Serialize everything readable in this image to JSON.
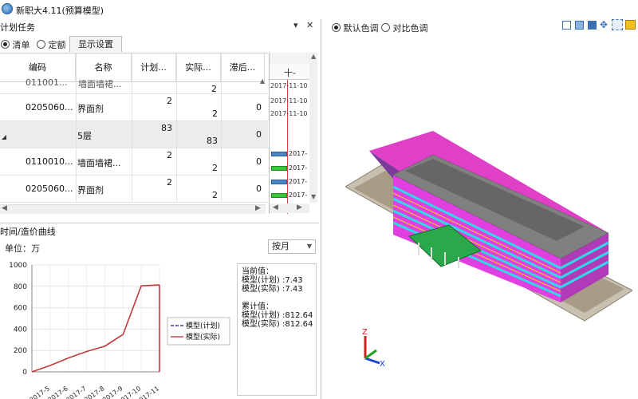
{
  "window": {
    "title": "新职大4.11(预算模型)"
  },
  "plan_pane": {
    "title": "计划任务",
    "pin_icon": "▾",
    "close_icon": "✕",
    "tabs": {
      "list": "清单",
      "quota": "定额",
      "display_settings": "显示设置"
    },
    "columns": [
      "编码",
      "名称",
      "计划...",
      "实际...",
      "滞后..."
    ],
    "rows": [
      {
        "code": "011001...",
        "name": "墙面墙裙...",
        "plan": "",
        "actual": "2",
        "lag": "0"
      },
      {
        "code": "0205060...",
        "name": "界面剂",
        "plan": "2",
        "actual": "2",
        "lag": "0"
      },
      {
        "code": "",
        "name": "5层",
        "plan": "83",
        "actual": "83",
        "lag": "0"
      },
      {
        "code": "0110010...",
        "name": "墙面墙裙...",
        "plan": "2",
        "actual": "2",
        "lag": "0"
      },
      {
        "code": "0205060...",
        "name": "界面剂",
        "plan": "2",
        "actual": "2",
        "lag": "0"
      }
    ],
    "gantt": {
      "header": "十-",
      "dates": [
        "2017-11-10",
        "2017-11-10",
        "2017-11-10"
      ],
      "bars": [
        "2017-",
        "2017-",
        "2017-",
        "2017-"
      ]
    }
  },
  "curve_pane": {
    "title": "时间/造价曲线",
    "unit_label": "单位：万",
    "period_select": "按月",
    "info": {
      "current_label": "当前值：",
      "current_plan": "模型(计划) :7.43",
      "current_actual": "模型(实际) :7.43",
      "cumulative_label": "累计值：",
      "cumulative_plan": "模型(计划) :812.64",
      "cumulative_actual": "模型(实际) :812.64"
    },
    "colors": {
      "plan": "#3a3aa8",
      "actual": "#c23a3a"
    }
  },
  "chart_data": {
    "type": "line",
    "title": "",
    "xlabel": "",
    "ylabel": "",
    "x": [
      "2017-4",
      "2017-5",
      "2017-6",
      "2017-7",
      "2017-8",
      "2017-9",
      "2017-10",
      "2017-11"
    ],
    "series": [
      {
        "name": "模型(计划)",
        "values": [
          0,
          60,
          130,
          190,
          240,
          350,
          805,
          812.64
        ]
      },
      {
        "name": "模型(实际)",
        "values": [
          0,
          60,
          130,
          190,
          240,
          350,
          805,
          812.64
        ]
      }
    ],
    "yticks": [
      0,
      200,
      400,
      600,
      800,
      1000
    ],
    "ylim": [
      0,
      1000
    ],
    "legend": "right",
    "grid": true
  },
  "view_pane": {
    "radio_default": "默认色调",
    "radio_compare": "对比色调",
    "axis_labels": {
      "z": "Z",
      "x": "X"
    }
  }
}
